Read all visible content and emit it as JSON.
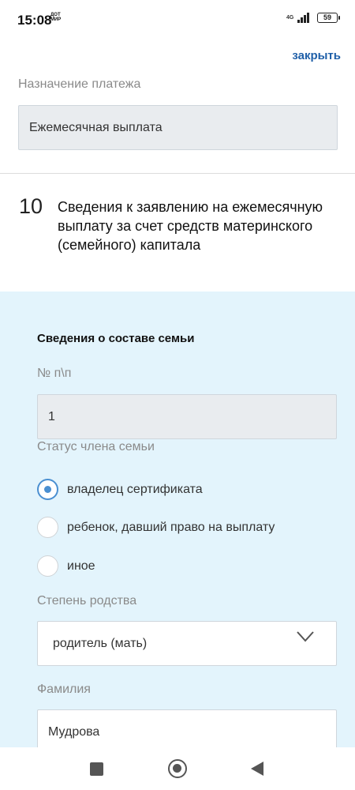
{
  "status": {
    "time": "15:08",
    "operator": "ДОТ МИР",
    "network": "4G",
    "battery": "59"
  },
  "header": {
    "close_label": "закрыть"
  },
  "payment": {
    "label": "Назначение платежа",
    "value": "Ежемесячная выплата"
  },
  "section": {
    "number": "10",
    "title": "Сведения к заявлению на ежемесячную выплату за счет средств материнского (семейного) капитала"
  },
  "family": {
    "title": "Сведения о составе семьи",
    "index_label": "№ п\\п",
    "index_value": "1",
    "status_label": "Статус члена семьи",
    "status_options": [
      {
        "label": "владелец сертификата",
        "checked": true
      },
      {
        "label": "ребенок, давший право на выплату",
        "checked": false
      },
      {
        "label": "иное",
        "checked": false
      }
    ],
    "relation_label": "Степень родства",
    "relation_value": "родитель (мать)",
    "surname_label": "Фамилия",
    "surname_value": "Мудрова"
  },
  "icons": {
    "chevron": "chevron-down-icon",
    "nav_recent": "square-icon",
    "nav_home": "circle-icon",
    "nav_back": "triangle-back-icon"
  },
  "colors": {
    "accent": "#4a8fd1",
    "link": "#1f5fa8",
    "panel_bg": "#e3f4fc",
    "readonly_bg": "#e9ecef"
  }
}
